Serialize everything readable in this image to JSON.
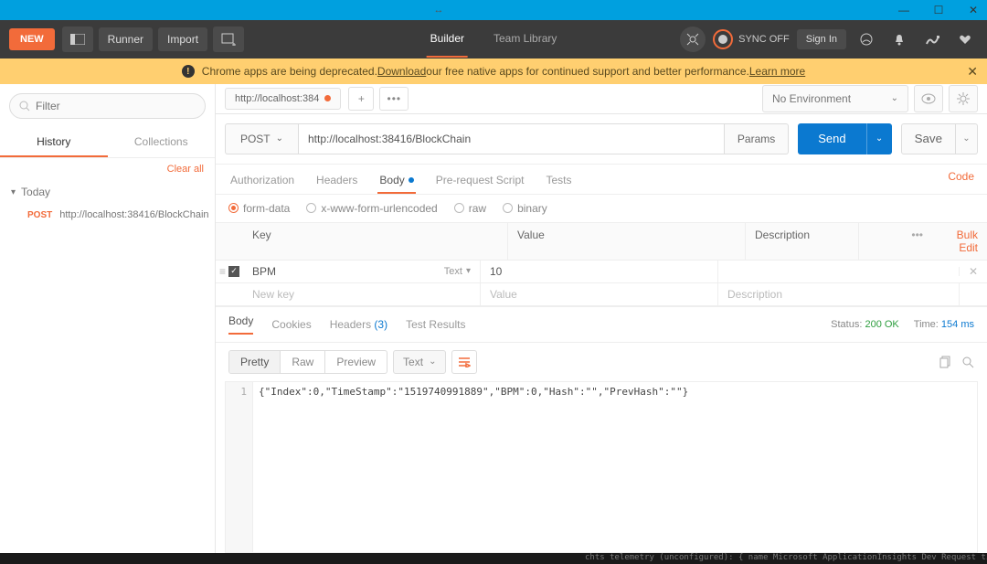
{
  "window": {
    "tabswap_icon": "↔"
  },
  "toolbar": {
    "new": "NEW",
    "runner": "Runner",
    "import": "Import",
    "tabs": {
      "builder": "Builder",
      "team": "Team Library"
    },
    "sync": "SYNC OFF",
    "signin": "Sign In"
  },
  "banner": {
    "pre": "Chrome apps are being deprecated. ",
    "link1": "Download",
    "mid": " our free native apps for continued support and better performance. ",
    "link2": "Learn more"
  },
  "sidebar": {
    "filter_placeholder": "Filter",
    "tabs": {
      "history": "History",
      "collections": "Collections"
    },
    "clear": "Clear all",
    "group": "Today",
    "items": [
      {
        "method": "POST",
        "url": "http://localhost:38416/BlockChain"
      }
    ]
  },
  "reqtab": {
    "label": "http://localhost:384"
  },
  "env": {
    "label": "No Environment"
  },
  "request": {
    "method": "POST",
    "url": "http://localhost:38416/BlockChain",
    "params": "Params",
    "send": "Send",
    "save": "Save",
    "subtabs": {
      "auth": "Authorization",
      "headers": "Headers",
      "body": "Body",
      "prereq": "Pre-request Script",
      "tests": "Tests"
    },
    "code_link": "Code",
    "body_types": {
      "formdata": "form-data",
      "url": "x-www-form-urlencoded",
      "raw": "raw",
      "binary": "binary"
    },
    "kv": {
      "head": {
        "key": "Key",
        "value": "Value",
        "desc": "Description",
        "bulk": "Bulk Edit"
      },
      "rows": [
        {
          "enabled": true,
          "key": "BPM",
          "type": "Text",
          "value": "10",
          "desc": ""
        }
      ],
      "placeholders": {
        "key": "New key",
        "value": "Value",
        "desc": "Description"
      }
    }
  },
  "response": {
    "tabs": {
      "body": "Body",
      "cookies": "Cookies",
      "headers": "Headers",
      "headers_count": "(3)",
      "tests": "Test Results"
    },
    "status_label": "Status:",
    "status_value": "200 OK",
    "time_label": "Time:",
    "time_value": "154 ms",
    "view": {
      "pretty": "Pretty",
      "raw": "Raw",
      "preview": "Preview"
    },
    "format": "Text",
    "body": "{\"Index\":0,\"TimeStamp\":\"1519740991889\",\"BPM\":0,\"Hash\":\"\",\"PrevHash\":\"\"}"
  },
  "footer": "chts  telemetry (unconfigured): { name   Microsoft ApplicationInsights Dev Request   time"
}
